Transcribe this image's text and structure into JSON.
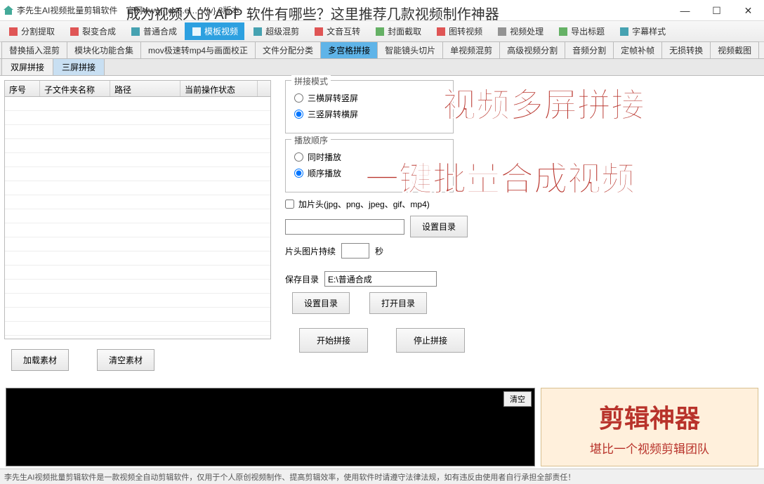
{
  "window": {
    "title": "李先生AI视频批量剪辑软件　官网www.{text}.e…　{v}.3版本",
    "overlay_title": "成为视频人的 APP 软件有哪些？这里推荐几款视频制作神器"
  },
  "toolbar": [
    {
      "label": "分割提取",
      "color": "#d44"
    },
    {
      "label": "裂变合成",
      "color": "#d44"
    },
    {
      "label": "普通合成",
      "color": "#39a"
    },
    {
      "label": "模板视频",
      "color": "#fff",
      "active": true
    },
    {
      "label": "超级混剪",
      "color": "#39a"
    },
    {
      "label": "文音互转",
      "color": "#d44"
    },
    {
      "label": "封面截取",
      "color": "#5a5"
    },
    {
      "label": "图转视频",
      "color": "#d44"
    },
    {
      "label": "视频处理",
      "color": "#888"
    },
    {
      "label": "导出标题",
      "color": "#5a5"
    },
    {
      "label": "字幕样式",
      "color": "#39a"
    }
  ],
  "tabs": [
    "替换插入混剪",
    "模块化功能合集",
    "mov极速转mp4与画面校正",
    "文件分配分类",
    "多宫格拼接",
    "智能镜头切片",
    "单视频混剪",
    "高级视频分割",
    "音频分割",
    "定帧补帧",
    "无损转换",
    "视频截图"
  ],
  "tabs_active": 4,
  "subtabs": [
    "双屏拼接",
    "三屏拼接"
  ],
  "subtabs_active": 1,
  "table": {
    "headers": [
      "序号",
      "子文件夹名称",
      "路径",
      "当前操作状态"
    ],
    "widths": [
      50,
      100,
      100,
      110
    ]
  },
  "left_buttons": {
    "add": "加载素材",
    "clear": "清空素材"
  },
  "splice_mode": {
    "legend": "拼接模式",
    "opt1": "三横屏转竖屏",
    "opt2": "三竖屏转横屏",
    "selected": 1
  },
  "play_order": {
    "legend": "播放顺序",
    "opt1": "同时播放",
    "opt2": "顺序播放",
    "selected": 1
  },
  "header_clip": {
    "checkbox": "加片头(jpg、png、jpeg、gif、mp4)",
    "set_dir": "设置目录",
    "duration_label": "片头图片持续",
    "duration_unit": "秒"
  },
  "save": {
    "label": "保存目录",
    "value": "E:\\普通合成",
    "set": "设置目录",
    "open": "打开目录"
  },
  "actions": {
    "start": "开始拼接",
    "stop": "停止拼接"
  },
  "overlays": {
    "line1": "视频多屏拼接",
    "line2": "一键批量合成视频"
  },
  "console": {
    "clear": "清空"
  },
  "promo": {
    "big": "剪辑神器",
    "small": "堪比一个视频剪辑团队"
  },
  "footer": "李先生AI视频批量剪辑软件是一款视频全自动剪辑软件，仅用于个人原创视频制作、提高剪辑效率，使用软件时请遵守法律法规，如有违反由使用者自行承担全部责任！"
}
